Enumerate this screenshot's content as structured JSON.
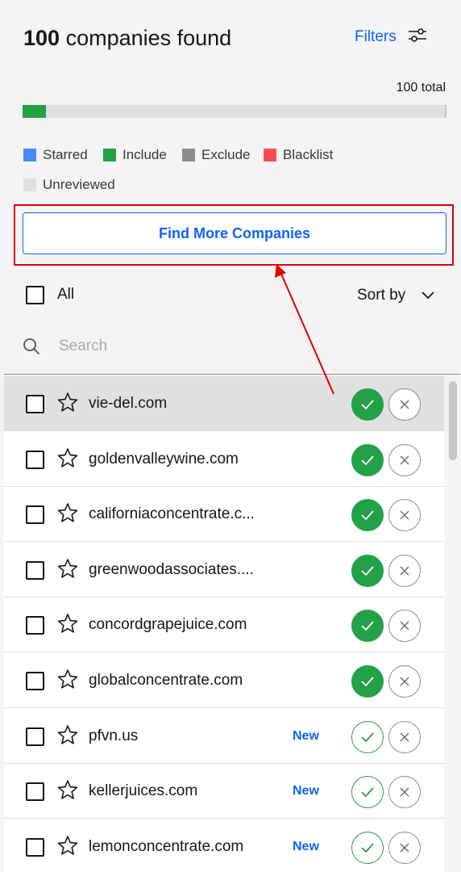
{
  "header": {
    "count": "100",
    "title_suffix": " companies found",
    "filters_label": "Filters"
  },
  "progress": {
    "total_label": "100 total",
    "include_fraction": 0.055
  },
  "legend": [
    {
      "label": "Starred",
      "color": "#4589ff"
    },
    {
      "label": "Include",
      "color": "#24a148"
    },
    {
      "label": "Exclude",
      "color": "#8d8d8d"
    },
    {
      "label": "Blacklist",
      "color": "#fa4d56"
    },
    {
      "label": "Unreviewed",
      "color": "#e0e0e0"
    }
  ],
  "actions": {
    "find_more_label": "Find More Companies"
  },
  "list_controls": {
    "select_all_label": "All",
    "sort_label": "Sort by"
  },
  "search": {
    "placeholder": "Search",
    "value": ""
  },
  "companies": [
    {
      "domain": "vie-del.com",
      "badge": "",
      "included": true
    },
    {
      "domain": "goldenvalleywine.com",
      "badge": "",
      "included": true
    },
    {
      "domain": "californiaconcentrate.c...",
      "badge": "",
      "included": true
    },
    {
      "domain": "greenwoodassociates....",
      "badge": "",
      "included": true
    },
    {
      "domain": "concordgrapejuice.com",
      "badge": "",
      "included": true
    },
    {
      "domain": "globalconcentrate.com",
      "badge": "",
      "included": true
    },
    {
      "domain": "pfvn.us",
      "badge": "New",
      "included": false
    },
    {
      "domain": "kellerjuices.com",
      "badge": "New",
      "included": false
    },
    {
      "domain": "lemonconcentrate.com",
      "badge": "New",
      "included": false
    }
  ],
  "colors": {
    "accent": "#0f62fe",
    "include": "#24a148",
    "highlight": "#e00000"
  }
}
